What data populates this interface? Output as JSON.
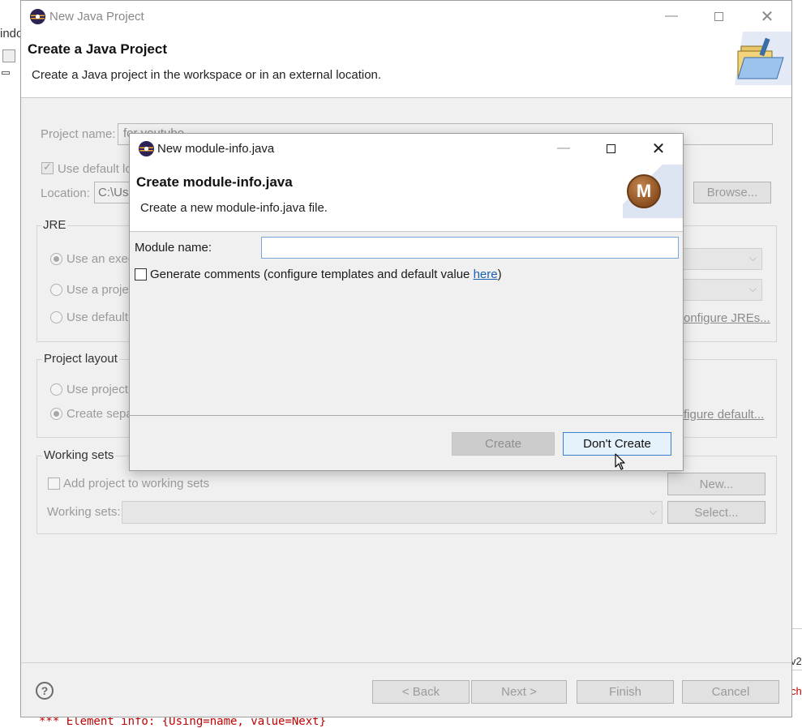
{
  "background": {
    "left_text": "indo",
    "code_line": "*** Element info: {Using=name, value=Next}",
    "right_frag1": "v2",
    "right_frag2": "ch"
  },
  "main_window": {
    "title": "New Java Project",
    "header_title": "Create a Java Project",
    "header_desc": "Create a Java project in the workspace or in an external location.",
    "project_name_label": "Project name:",
    "project_name_value": "for youtube",
    "use_default_location_label": "Use default lo",
    "location_label": "Location:",
    "location_value": "C:\\Use",
    "browse_button": "Browse...",
    "jre": {
      "title": "JRE",
      "option1": "Use an exec",
      "option2": "Use a proje",
      "option3": "Use default",
      "configure_link": "onfigure JREs..."
    },
    "project_layout": {
      "title": "Project layout",
      "option1": "Use project",
      "option2": "Create sepa",
      "configure_link": "figure default..."
    },
    "working_sets": {
      "title": "Working sets",
      "add_label": "Add project to working sets",
      "new_button": "New...",
      "sets_label": "Working sets:",
      "select_button": "Select..."
    },
    "footer": {
      "help": "?",
      "back": "< Back",
      "next": "Next >",
      "finish": "Finish",
      "cancel": "Cancel"
    }
  },
  "dialog": {
    "title": "New module-info.java",
    "header_title": "Create module-info.java",
    "header_desc": "Create a new module-info.java file.",
    "module_icon_letter": "M",
    "module_name_label": "Module name:",
    "module_name_value": "",
    "generate_comments_label": "Generate comments (configure templates and default value ",
    "here_link": "here",
    "generate_comments_suffix": ")",
    "create_button": "Create",
    "dont_create_button": "Don't Create"
  },
  "colors": {
    "dialog_bg": "#f0f0f0",
    "accent_border": "#3a7fcf",
    "link": "#1b5fb5",
    "code_red": "#c00000"
  }
}
